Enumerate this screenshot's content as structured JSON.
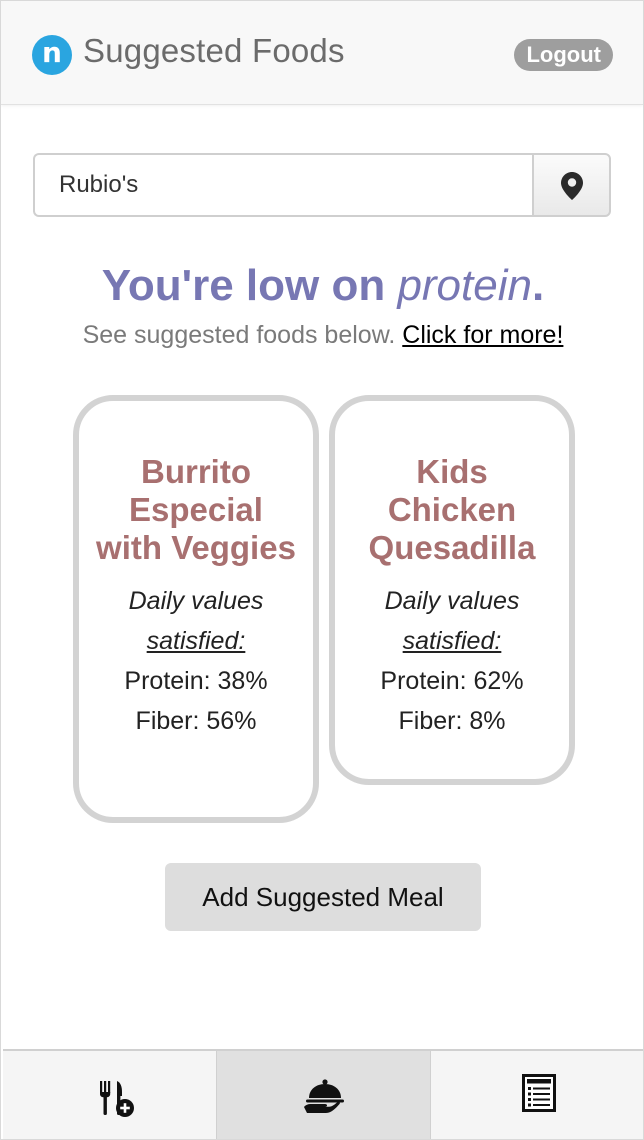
{
  "header": {
    "logo_letter": "n",
    "title": "Suggested Foods",
    "logout_label": "Logout"
  },
  "search": {
    "value": "Rubio's",
    "location_icon": "map-pin-icon"
  },
  "message": {
    "prefix": "You're low on ",
    "nutrient": "protein",
    "suffix": ".",
    "sub_text": "See suggested foods below. ",
    "link_text": "Click for more!"
  },
  "cards": [
    {
      "name": "Burrito Especial with Veggies",
      "dv_label": "Daily values",
      "dv_sub": "satisfied:",
      "protein": "Protein: 38%",
      "fiber": "Fiber: 56%"
    },
    {
      "name": "Kids Chicken Quesadilla",
      "dv_label": "Daily values",
      "dv_sub": "satisfied:",
      "protein": "Protein: 62%",
      "fiber": "Fiber: 8%"
    }
  ],
  "add_meal_label": "Add Suggested Meal",
  "nav": [
    {
      "icon": "fork-knife-add-icon",
      "active": false
    },
    {
      "icon": "serving-cloche-icon",
      "active": true
    },
    {
      "icon": "list-document-icon",
      "active": false
    }
  ],
  "colors": {
    "logo": "#2aa5e0",
    "headline": "#7777b3",
    "card_title": "#a87070",
    "card_border": "#d3d3d3",
    "logout_bg": "#9e9e9e"
  }
}
